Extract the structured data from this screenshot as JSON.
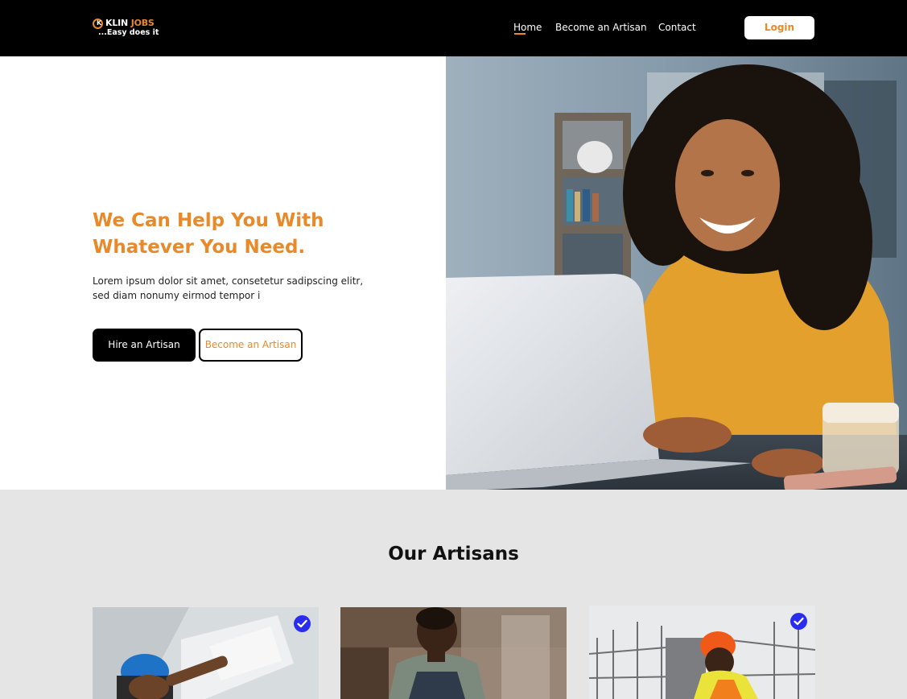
{
  "brand": {
    "name_main": "KLIN",
    "name_accent": "JOBS",
    "mark": "K",
    "tagline": "...Easy does it"
  },
  "nav": {
    "items": [
      {
        "label": "Home",
        "active": true
      },
      {
        "label": "Become an Artisan",
        "active": false
      },
      {
        "label": "Contact",
        "active": false
      }
    ],
    "login_label": "Login"
  },
  "hero": {
    "title": "We Can Help You With Whatever You Need.",
    "subtitle": "Lorem ipsum dolor sit amet, consetetur sadipscing elitr, sed diam nonumy eirmod tempor i",
    "primary_button": "Hire an Artisan",
    "secondary_button": "Become an Artisan"
  },
  "artisans": {
    "title": "Our Artisans",
    "cards": [
      {
        "verified": true
      },
      {
        "verified": false
      },
      {
        "verified": true
      }
    ]
  },
  "colors": {
    "accent": "#e8892a",
    "header_bg": "#000000",
    "section_bg": "#e5e5e5",
    "verified_badge": "#2a2df0"
  },
  "icons": {
    "verified": "check-circle-icon"
  }
}
